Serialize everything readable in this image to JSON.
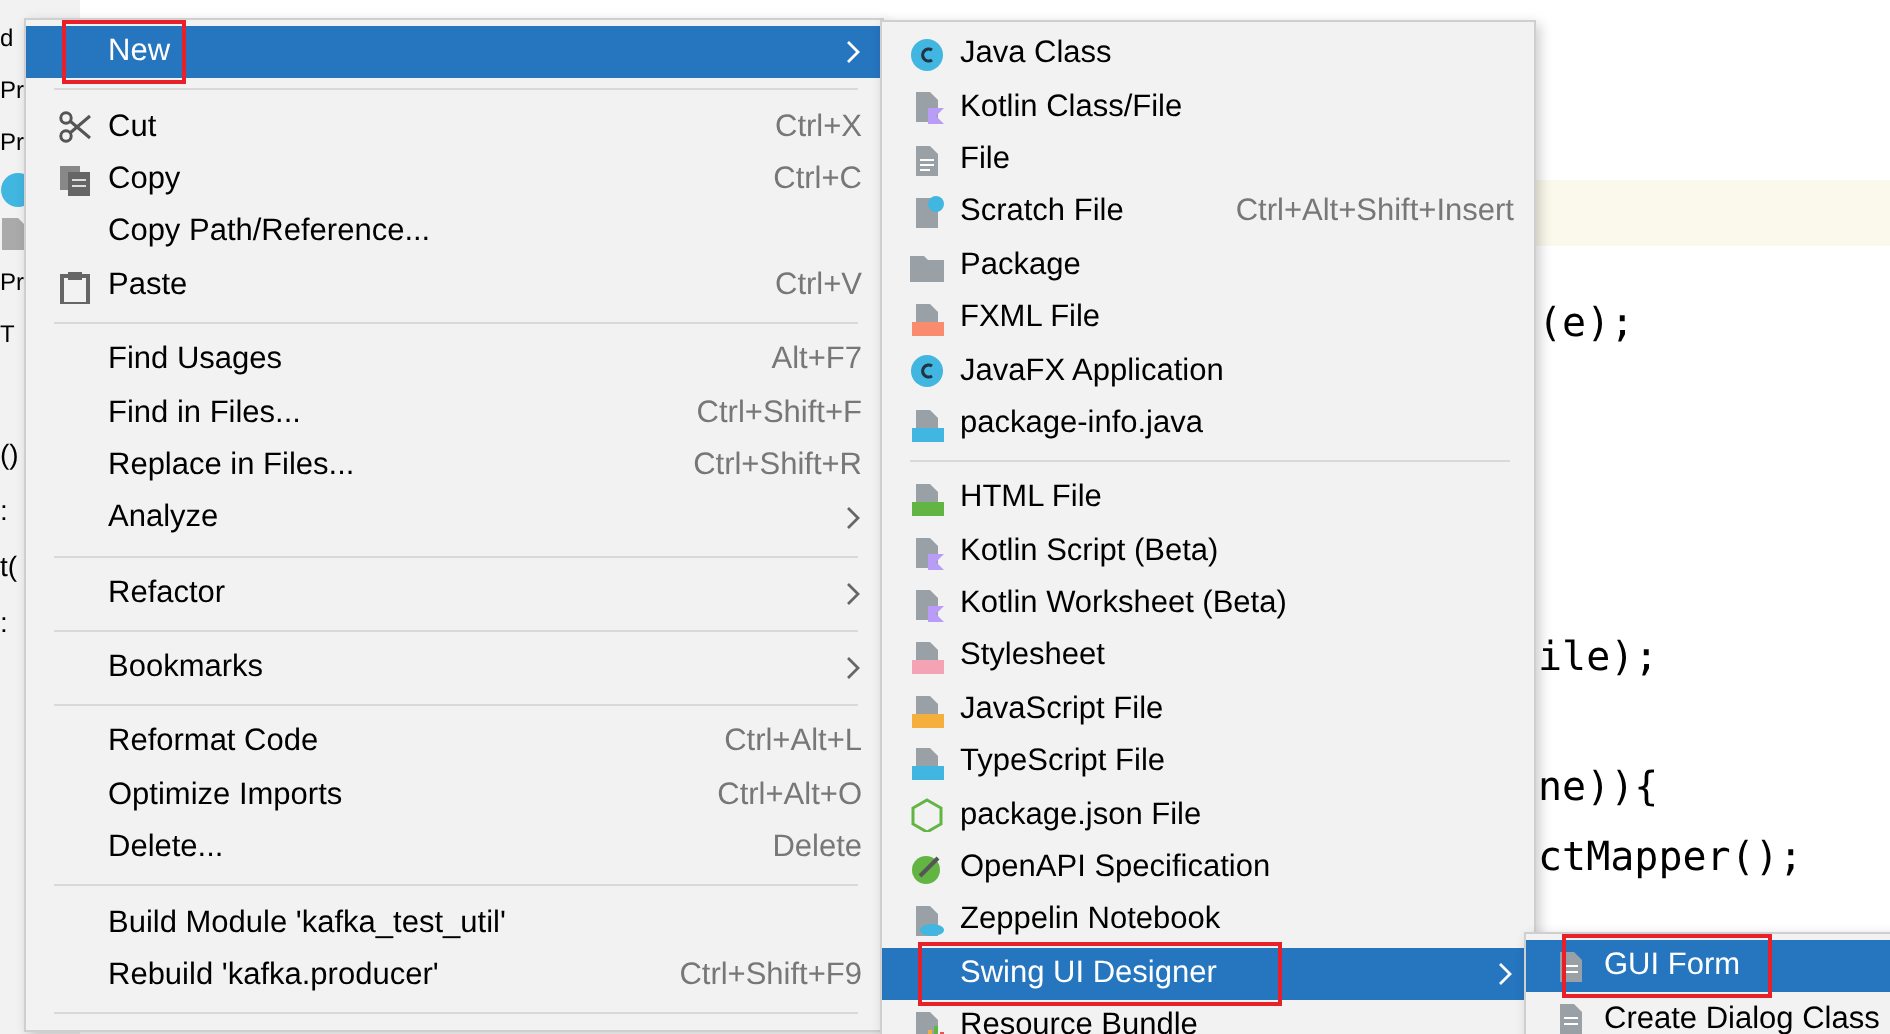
{
  "project_panel": {
    "fragments": [
      {
        "text": "d",
        "kind": "text"
      },
      {
        "text": "Pr",
        "kind": "text"
      },
      {
        "text": "Pr",
        "kind": "text"
      },
      {
        "kind": "class-icon"
      },
      {
        "kind": "file-icon"
      },
      {
        "text": "Pr",
        "kind": "text"
      },
      {
        "text": "T",
        "kind": "text"
      }
    ]
  },
  "console_fragments": [
    "()",
    ":",
    "t(",
    ":"
  ],
  "editor": {
    "lines": [
      {
        "highlighted": true
      },
      {
        "text": "(e);",
        "highlighted": false
      },
      {
        "text": "ile);",
        "highlighted": false
      },
      {
        "text": "ne)){",
        "highlighted": false
      },
      {
        "text": "ctMapper();",
        "highlighted": false
      }
    ]
  },
  "context_menu": {
    "items": [
      {
        "kind": "item",
        "label": "New",
        "submenu": true,
        "selected": true,
        "annotated": true
      },
      {
        "kind": "separator"
      },
      {
        "kind": "item",
        "label": "Cut",
        "shortcut": "Ctrl+X",
        "selected": false,
        "annotated": false
      },
      {
        "kind": "item",
        "label": "Copy",
        "shortcut": "Ctrl+C",
        "selected": false,
        "annotated": false
      },
      {
        "kind": "item",
        "label": "Copy Path/Reference...",
        "selected": false,
        "annotated": false
      },
      {
        "kind": "item",
        "label": "Paste",
        "shortcut": "Ctrl+V",
        "selected": false,
        "annotated": false
      },
      {
        "kind": "separator"
      },
      {
        "kind": "item",
        "label": "Find Usages",
        "shortcut": "Alt+F7",
        "selected": false,
        "annotated": false
      },
      {
        "kind": "item",
        "label": "Find in Files...",
        "shortcut": "Ctrl+Shift+F",
        "selected": false,
        "annotated": false
      },
      {
        "kind": "item",
        "label": "Replace in Files...",
        "shortcut": "Ctrl+Shift+R",
        "selected": false,
        "annotated": false
      },
      {
        "kind": "item",
        "label": "Analyze",
        "submenu": true,
        "selected": false,
        "annotated": false
      },
      {
        "kind": "separator"
      },
      {
        "kind": "item",
        "label": "Refactor",
        "submenu": true,
        "selected": false,
        "annotated": false
      },
      {
        "kind": "separator"
      },
      {
        "kind": "item",
        "label": "Bookmarks",
        "submenu": true,
        "selected": false,
        "annotated": false
      },
      {
        "kind": "separator"
      },
      {
        "kind": "item",
        "label": "Reformat Code",
        "shortcut": "Ctrl+Alt+L",
        "selected": false,
        "annotated": false
      },
      {
        "kind": "item",
        "label": "Optimize Imports",
        "shortcut": "Ctrl+Alt+O",
        "selected": false,
        "annotated": false
      },
      {
        "kind": "item",
        "label": "Delete...",
        "shortcut": "Delete",
        "selected": false,
        "annotated": false
      },
      {
        "kind": "separator"
      },
      {
        "kind": "item",
        "label": "Build Module 'kafka_test_util'",
        "selected": false,
        "annotated": false
      },
      {
        "kind": "item",
        "label": "Rebuild 'kafka.producer'",
        "shortcut": "Ctrl+Shift+F9",
        "selected": false,
        "annotated": false
      },
      {
        "kind": "separator"
      }
    ]
  },
  "new_submenu": {
    "items": [
      {
        "kind": "item",
        "label": "Java Class",
        "selected": false,
        "annotated": false
      },
      {
        "kind": "item",
        "label": "Kotlin Class/File",
        "selected": false,
        "annotated": false
      },
      {
        "kind": "item",
        "label": "File",
        "selected": false,
        "annotated": false
      },
      {
        "kind": "item",
        "label": "Scratch File",
        "shortcut": "Ctrl+Alt+Shift+Insert",
        "selected": false,
        "annotated": false
      },
      {
        "kind": "item",
        "label": "Package",
        "selected": false,
        "annotated": false
      },
      {
        "kind": "item",
        "label": "FXML File",
        "selected": false,
        "annotated": false
      },
      {
        "kind": "item",
        "label": "JavaFX Application",
        "selected": false,
        "annotated": false
      },
      {
        "kind": "item",
        "label": "package-info.java",
        "selected": false,
        "annotated": false
      },
      {
        "kind": "separator"
      },
      {
        "kind": "item",
        "label": "HTML File",
        "selected": false,
        "annotated": false
      },
      {
        "kind": "item",
        "label": "Kotlin Script (Beta)",
        "selected": false,
        "annotated": false
      },
      {
        "kind": "item",
        "label": "Kotlin Worksheet (Beta)",
        "selected": false,
        "annotated": false
      },
      {
        "kind": "item",
        "label": "Stylesheet",
        "selected": false,
        "annotated": false
      },
      {
        "kind": "item",
        "label": "JavaScript File",
        "selected": false,
        "annotated": false
      },
      {
        "kind": "item",
        "label": "TypeScript File",
        "selected": false,
        "annotated": false
      },
      {
        "kind": "item",
        "label": "package.json File",
        "selected": false,
        "annotated": false
      },
      {
        "kind": "item",
        "label": "OpenAPI Specification",
        "selected": false,
        "annotated": false
      },
      {
        "kind": "item",
        "label": "Zeppelin Notebook",
        "selected": false,
        "annotated": false
      },
      {
        "kind": "item",
        "label": "Swing UI Designer",
        "submenu": true,
        "selected": true,
        "annotated": true
      },
      {
        "kind": "item",
        "label": "Resource Bundle",
        "selected": false,
        "annotated": false
      }
    ]
  },
  "swing_submenu": {
    "items": [
      {
        "kind": "item",
        "label": "GUI Form",
        "selected": true,
        "annotated": true
      },
      {
        "kind": "item",
        "label": "Create Dialog Class",
        "selected": false,
        "annotated": false
      }
    ]
  }
}
